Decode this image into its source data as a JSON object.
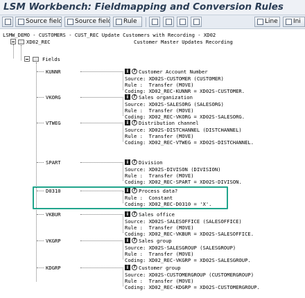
{
  "window": {
    "title": "LSM Workbench: Fieldmapping and Conversion Rules"
  },
  "toolbar": {
    "buttons": [
      {
        "label": "",
        "icon": "page-icon"
      },
      {
        "label": "Source field",
        "icon": "source-field-icon"
      },
      {
        "label": "Source field",
        "icon": "source-field-icon"
      },
      {
        "label": "Rule",
        "icon": "rule-icon"
      },
      {
        "label": "",
        "icon": "grid-icon"
      },
      {
        "label": "",
        "icon": "grid-icon"
      },
      {
        "label": "",
        "icon": "grid-icon"
      },
      {
        "label": "",
        "icon": "grid-icon"
      },
      {
        "label": "Line",
        "icon": "line-icon"
      },
      {
        "label": "Ini",
        "icon": "init-icon"
      }
    ]
  },
  "tree": {
    "root": "LSMW_DEMO - CUSTOMERS - CUST_REC Update Customers with Recording - XD02",
    "structure": {
      "name": "XD02_REC",
      "description": "Customer Master Updates Recording"
    },
    "fields_label": "Fields",
    "fields": [
      {
        "name": "KUNNR",
        "description": "Customer Account Number",
        "lines": [
          "Source: XD02S-CUSTOMER (CUSTOMER)",
          "Rule :  Transfer (MOVE)",
          "Coding: XD02_REC-KUNNR = XD02S-CUSTOMER."
        ]
      },
      {
        "name": "VKORG",
        "description": "Sales organization",
        "lines": [
          "Source: XD02S-SALESORG (SALESORG)",
          "Rule :  Transfer (MOVE)",
          "Coding: XD02_REC-VKORG = XD02S-SALESORG."
        ]
      },
      {
        "name": "VTWEG",
        "description": "Distribution channel",
        "lines": [
          "Source: XD02S-DISTCHANNEL (DISTCHANNEL)",
          "Rule :  Transfer (MOVE)",
          "Coding: XD02_REC-VTWEG = XD02S-DISTCHANNEL."
        ]
      },
      {
        "name": "SPART",
        "description": "Division",
        "lines": [
          "Source: XD02S-DIVISON (DIVISION)",
          "Rule :  Transfer (MOVE)",
          "Coding: XD02_REC-SPART = XD02S-DIVISON."
        ]
      },
      {
        "name": "D0310",
        "description": "Process data?",
        "lines": [
          "Rule :  Constant",
          "Coding: XD02_REC-D0310 = 'X'."
        ]
      },
      {
        "name": "VKBUR",
        "description": "Sales office",
        "lines": [
          "Source: XD02S-SALESOFFICE (SALESOFFICE)",
          "Rule :  Transfer (MOVE)",
          "Coding: XD02_REC-VKBUR = XD02S-SALESOFFICE."
        ]
      },
      {
        "name": "VKGRP",
        "description": "Sales group",
        "lines": [
          "Source: XD02S-SALESGROUP (SALESGROUP)",
          "Rule :  Transfer (MOVE)",
          "Coding: XD02_REC-VKGRP = XD02S-SALESGROUP."
        ]
      },
      {
        "name": "KDGRP",
        "description": "Customer group",
        "lines": [
          "Source: XD02S-CUSTOMERGROUP (CUSTOMERGROUP)",
          "Rule :  Transfer (MOVE)",
          "Coding: XD02_REC-KDGRP = XD02S-CUSTOMERGROUP."
        ]
      }
    ]
  },
  "colors": {
    "highlight": "#21a58c",
    "title": "#2a3d55"
  }
}
